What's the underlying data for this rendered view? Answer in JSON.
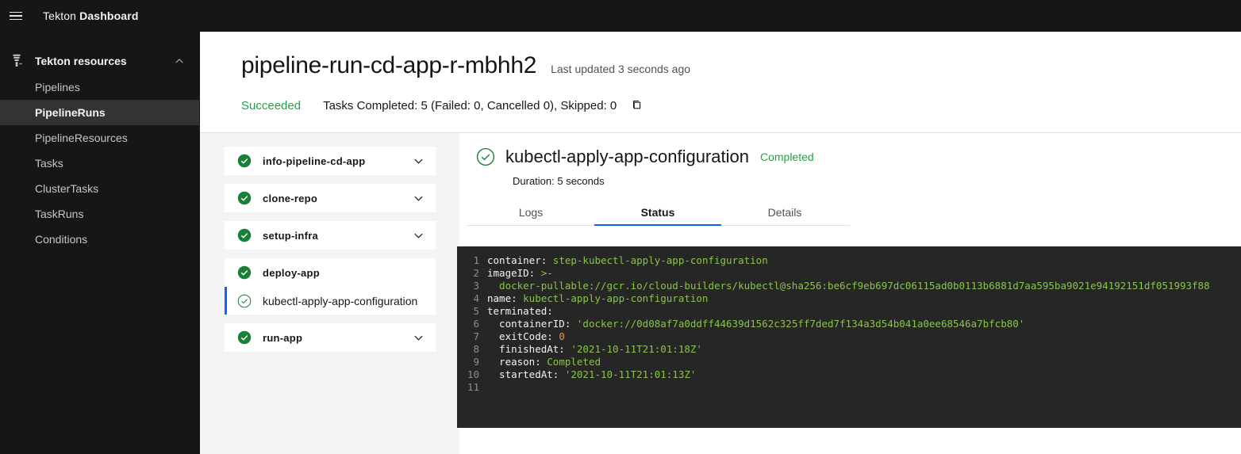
{
  "header": {
    "menu_icon": "hamburger-menu-icon",
    "title_light": "Tekton ",
    "title_bold": "Dashboard"
  },
  "sidebar": {
    "logo_icon": "tekton-logo-icon",
    "section_label": "Tekton resources",
    "collapse_icon": "chevron-up-icon",
    "items": [
      {
        "label": "Pipelines",
        "active": false
      },
      {
        "label": "PipelineRuns",
        "active": true
      },
      {
        "label": "PipelineResources",
        "active": false
      },
      {
        "label": "Tasks",
        "active": false
      },
      {
        "label": "ClusterTasks",
        "active": false
      },
      {
        "label": "TaskRuns",
        "active": false
      },
      {
        "label": "Conditions",
        "active": false
      }
    ]
  },
  "run": {
    "title": "pipeline-run-cd-app-r-mbhh2",
    "last_updated": "Last updated 3 seconds ago",
    "status": "Succeeded",
    "tasks_summary": "Tasks Completed: 5 (Failed: 0, Cancelled 0), Skipped: 0",
    "copy_icon": "copy-icon",
    "status_color": "#24a148"
  },
  "tasks": [
    {
      "name": "info-pipeline-cd-app",
      "status_icon": "check-filled-icon",
      "expanded": false,
      "chevron": "chevron-down-icon",
      "steps": []
    },
    {
      "name": "clone-repo",
      "status_icon": "check-filled-icon",
      "expanded": false,
      "chevron": "chevron-down-icon",
      "steps": []
    },
    {
      "name": "setup-infra",
      "status_icon": "check-filled-icon",
      "expanded": false,
      "chevron": "chevron-down-icon",
      "steps": []
    },
    {
      "name": "deploy-app",
      "status_icon": "check-filled-icon",
      "expanded": true,
      "chevron": "",
      "steps": [
        {
          "name": "kubectl-apply-app-configuration",
          "status_icon": "check-outline-icon",
          "selected": true
        }
      ]
    },
    {
      "name": "run-app",
      "status_icon": "check-filled-icon",
      "expanded": false,
      "chevron": "chevron-down-icon",
      "steps": []
    }
  ],
  "detail": {
    "status_icon": "check-outline-icon",
    "title": "kubectl-apply-app-configuration",
    "status": "Completed",
    "duration": "Duration: 5 seconds",
    "tabs": [
      {
        "label": "Logs",
        "active": false
      },
      {
        "label": "Status",
        "active": true
      },
      {
        "label": "Details",
        "active": false
      }
    ],
    "accent_color": "#0f62fe"
  },
  "code": {
    "background": "#262626",
    "lines": [
      {
        "n": "1",
        "tokens": [
          {
            "t": "container: ",
            "c": "key"
          },
          {
            "t": "step-kubectl-apply-app-configuration",
            "c": "str"
          }
        ]
      },
      {
        "n": "2",
        "tokens": [
          {
            "t": "imageID: ",
            "c": "key"
          },
          {
            "t": ">-",
            "c": "str"
          }
        ]
      },
      {
        "n": "3",
        "tokens": [
          {
            "t": "  docker-pullable://gcr.io/cloud-builders/kubectl@sha256:be6cf9eb697dc06115ad0b0113b6881d7aa595ba9021e94192151df051993f88",
            "c": "str"
          }
        ]
      },
      {
        "n": "4",
        "tokens": [
          {
            "t": "name: ",
            "c": "key"
          },
          {
            "t": "kubectl-apply-app-configuration",
            "c": "str"
          }
        ]
      },
      {
        "n": "5",
        "tokens": [
          {
            "t": "terminated:",
            "c": "key"
          }
        ]
      },
      {
        "n": "6",
        "tokens": [
          {
            "t": "  containerID: ",
            "c": "key"
          },
          {
            "t": "'docker://0d08af7a0ddff44639d1562c325ff7ded7f134a3d54b041a0ee68546a7bfcb80'",
            "c": "str"
          }
        ]
      },
      {
        "n": "7",
        "tokens": [
          {
            "t": "  exitCode: ",
            "c": "key"
          },
          {
            "t": "0",
            "c": "num"
          }
        ]
      },
      {
        "n": "8",
        "tokens": [
          {
            "t": "  finishedAt: ",
            "c": "key"
          },
          {
            "t": "'2021-10-11T21:01:18Z'",
            "c": "str"
          }
        ]
      },
      {
        "n": "9",
        "tokens": [
          {
            "t": "  reason: ",
            "c": "key"
          },
          {
            "t": "Completed",
            "c": "str"
          }
        ]
      },
      {
        "n": "10",
        "tokens": [
          {
            "t": "  startedAt: ",
            "c": "key"
          },
          {
            "t": "'2021-10-11T21:01:13Z'",
            "c": "str"
          }
        ]
      },
      {
        "n": "11",
        "tokens": []
      }
    ]
  }
}
